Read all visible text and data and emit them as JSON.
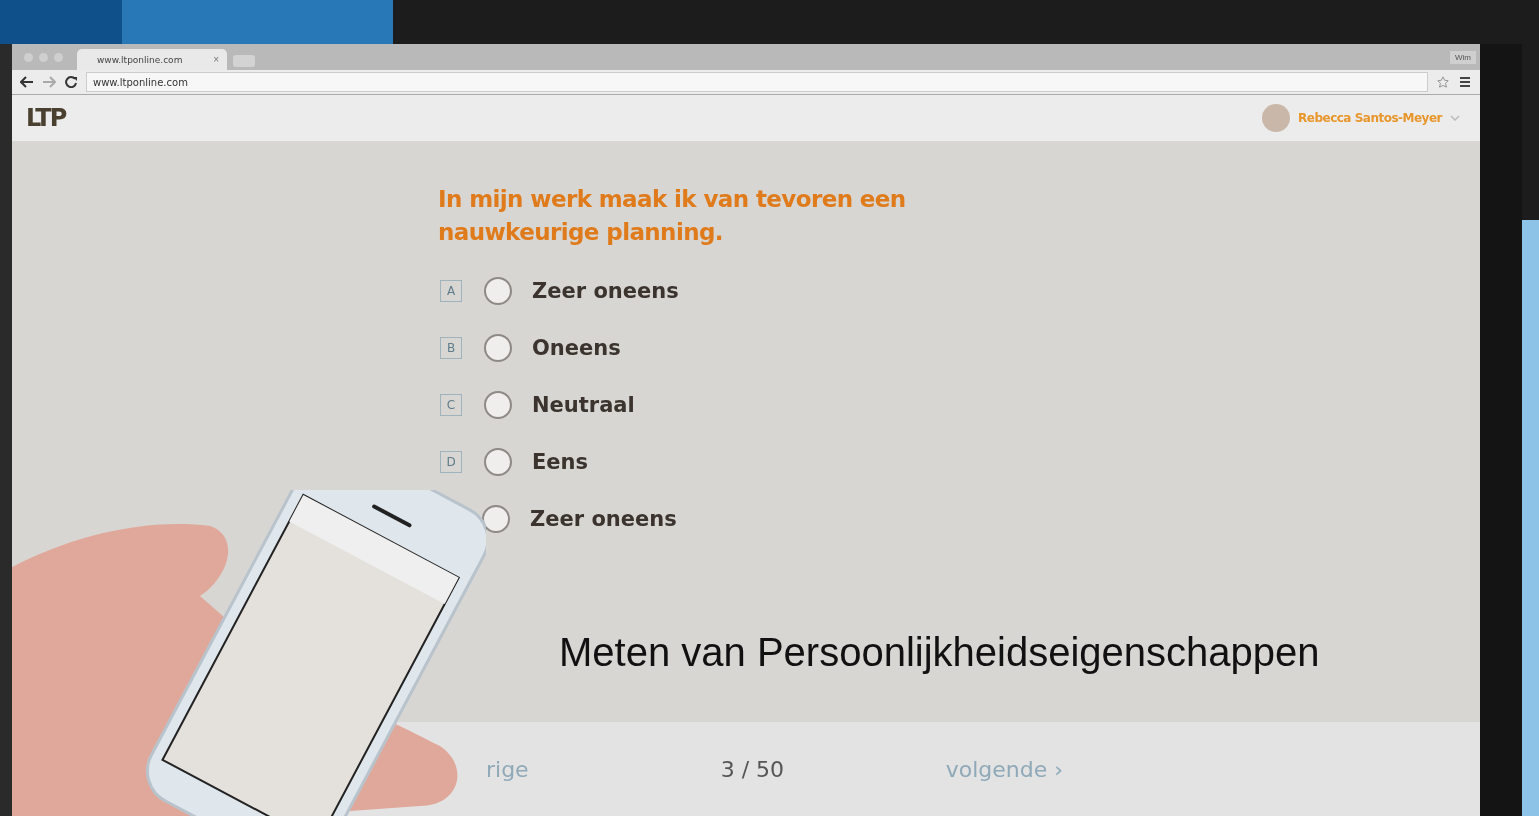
{
  "browser": {
    "tab": {
      "title": "www.ltponline.com",
      "close": "×"
    },
    "address": "www.ltponline.com",
    "profile_button": "Wim"
  },
  "app": {
    "logo": "LTP",
    "user": {
      "name": "Rebecca Santos-Meyer"
    }
  },
  "question": {
    "text": "In mijn werk maak ik van tevoren een nauwkeurige planning.",
    "options": [
      {
        "letter": "A",
        "label": "Zeer oneens",
        "selected": false
      },
      {
        "letter": "B",
        "label": "Oneens",
        "selected": false
      },
      {
        "letter": "C",
        "label": "Neutraal",
        "selected": false
      },
      {
        "letter": "D",
        "label": "Eens",
        "selected": false
      },
      {
        "label": "Zeer oneens",
        "selected": false
      }
    ]
  },
  "caption": "Meten van Persoonlijkheidseigenschappen",
  "footer": {
    "previous": "rige",
    "progress": "3 / 50",
    "next": "volgende ›"
  }
}
